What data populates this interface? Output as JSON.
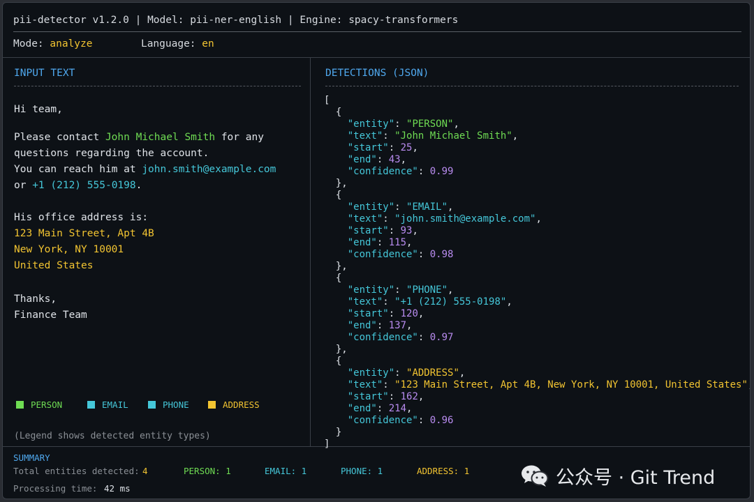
{
  "header": {
    "app": "pii-detector v1.2.0",
    "sep1": "|",
    "model_label": "Model:",
    "model": "pii-ner-english",
    "sep2": "|",
    "engine_label": "Engine:",
    "engine": "spacy-transformers"
  },
  "mode": {
    "mode_label": "Mode:",
    "mode_value": "analyze",
    "lang_label": "Language:",
    "lang_value": "en"
  },
  "input_panel": {
    "title": "INPUT TEXT",
    "lines": {
      "greeting": "Hi team,",
      "l1a": "Please contact ",
      "l1b": "John Michael Smith",
      "l1c": " for any",
      "l2": "questions regarding the account.",
      "l3a": "You can reach him at ",
      "l3b": "john.smith@example.com",
      "l4a": "or ",
      "l4b": "+1 (212) 555-0198",
      "l4c": ".",
      "l5": "His office address is:",
      "addr1": "123 Main Street, Apt 4B",
      "addr2": "New York, NY 10001",
      "addr3": "United States",
      "l6": "Thanks,",
      "l7": "Finance Team"
    },
    "legend": [
      {
        "label": "PERSON",
        "color": "#6fdc53"
      },
      {
        "label": "EMAIL",
        "color": "#45c7d9"
      },
      {
        "label": "PHONE",
        "color": "#45c7d9"
      },
      {
        "label": "ADDRESS",
        "color": "#f2c431"
      }
    ],
    "legend_note": "(Legend shows detected entity types)"
  },
  "detections_panel": {
    "title": "DETECTIONS (JSON)",
    "entities": [
      {
        "entity": "PERSON",
        "text": "John Michael Smith",
        "start": 25,
        "end": 43,
        "confidence": 0.99,
        "color": "#6fdc53"
      },
      {
        "entity": "EMAIL",
        "text": "john.smith@example.com",
        "start": 93,
        "end": 115,
        "confidence": 0.98,
        "color": "#45c7d9"
      },
      {
        "entity": "PHONE",
        "text": "+1 (212) 555-0198",
        "start": 120,
        "end": 137,
        "confidence": 0.97,
        "color": "#45c7d9"
      },
      {
        "entity": "ADDRESS",
        "text": "123 Main Street, Apt 4B, New York, NY 10001, United States",
        "start": 162,
        "end": 214,
        "confidence": 0.96,
        "color": "#f2c431"
      }
    ]
  },
  "summary": {
    "title": "SUMMARY",
    "total_label": "Total entities detected:",
    "total": "4",
    "person": "PERSON: 1",
    "email": "EMAIL: 1",
    "phone": "PHONE: 1",
    "address": "ADDRESS: 1",
    "time_label": "Processing time:",
    "time": "42 ms"
  },
  "watermark": {
    "text": "公众号 · Git Trend",
    "icon": "wechat-icon"
  }
}
